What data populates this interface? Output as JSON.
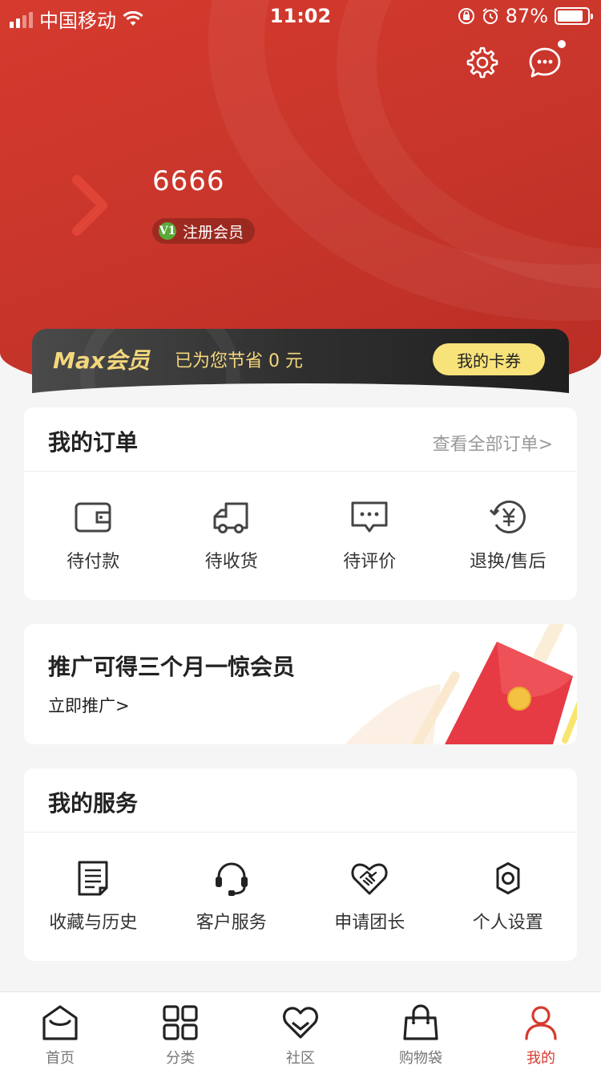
{
  "status_bar": {
    "carrier": "中国移动",
    "time": "11:02",
    "battery": "87%"
  },
  "profile": {
    "username": "6666",
    "badge_level": "V1",
    "member_label": "注册会员"
  },
  "max_card": {
    "title": "Max会员",
    "saving": "已为您节省 0 元",
    "button": "我的卡券"
  },
  "orders": {
    "title": "我的订单",
    "view_all": "查看全部订单>",
    "items": [
      {
        "label": "待付款",
        "icon": "wallet-icon"
      },
      {
        "label": "待收货",
        "icon": "truck-icon"
      },
      {
        "label": "待评价",
        "icon": "comment-icon"
      },
      {
        "label": "退换/售后",
        "icon": "refund-icon"
      }
    ]
  },
  "promo": {
    "title": "推广可得三个月一惊会员",
    "link": "立即推广>"
  },
  "services": {
    "title": "我的服务",
    "items": [
      {
        "label": "收藏与历史",
        "icon": "document-icon"
      },
      {
        "label": "客户服务",
        "icon": "headset-icon"
      },
      {
        "label": "申请团长",
        "icon": "handshake-icon"
      },
      {
        "label": "个人设置",
        "icon": "gear-icon"
      }
    ]
  },
  "tabbar": {
    "items": [
      {
        "label": "首页",
        "icon": "home-icon"
      },
      {
        "label": "分类",
        "icon": "grid-icon"
      },
      {
        "label": "社区",
        "icon": "heart-icon"
      },
      {
        "label": "购物袋",
        "icon": "bag-icon"
      },
      {
        "label": "我的",
        "icon": "user-icon",
        "active": true
      }
    ]
  },
  "colors": {
    "brand_red": "#d63a2e",
    "gold": "#f4d77d",
    "card_button": "#f8e27a"
  }
}
